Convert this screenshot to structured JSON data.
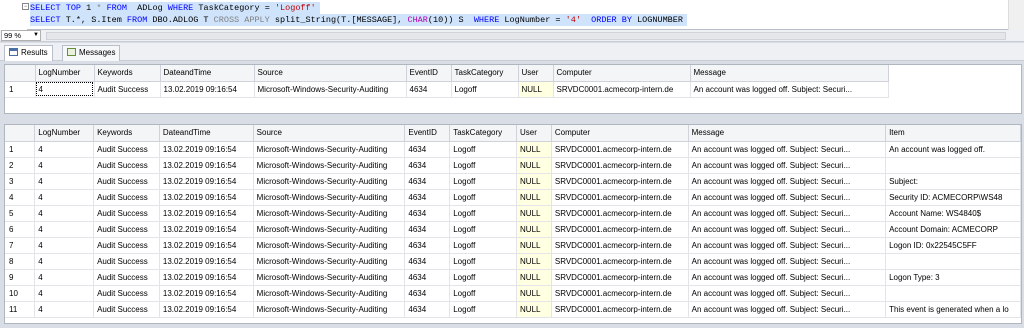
{
  "editor": {
    "line1": {
      "k1": "SELECT",
      "k2": "TOP",
      "n": "1",
      "t1": " * ",
      "k3": "FROM",
      "t2": "  ADLog ",
      "k4": "WHERE",
      "t3": " TaskCategory = ",
      "s": "'Logoff'"
    },
    "line2": {
      "k1": "SELECT",
      "t1": " T.*, S.Item ",
      "k2": "FROM",
      "t2": " DBO.ADLOG T ",
      "k3": "CROSS APPLY",
      "t3": " split_String(T.[MESSAGE], ",
      "fn": "CHAR",
      "t4": "(10)) S  ",
      "k4": "WHERE",
      "t5": " LogNumber = ",
      "s": "'4'",
      "t6": "  ",
      "k5": "ORDER BY",
      "t7": " LOGNUMBER"
    }
  },
  "zoom": "99 %",
  "tabs": {
    "results": "Results",
    "messages": "Messages"
  },
  "columns": [
    "LogNumber",
    "Keywords",
    "DateandTime",
    "Source",
    "EventID",
    "TaskCategory",
    "User",
    "Computer",
    "Message",
    "Item"
  ],
  "result1": [
    {
      "rn": "1",
      "log": "4",
      "kw": "Audit Success",
      "dt": "13.02.2019 09:16:54",
      "src": "Microsoft-Windows-Security-Auditing",
      "eid": "4634",
      "task": "Logoff",
      "user": "NULL",
      "comp": "SRVDC0001.acmecorp-intern.de",
      "msg": "An account was logged off.   Subject:   Securi..."
    }
  ],
  "result2": [
    {
      "rn": "1",
      "item": "An account was logged off."
    },
    {
      "rn": "2",
      "item": ""
    },
    {
      "rn": "3",
      "item": "Subject:"
    },
    {
      "rn": "4",
      "item": "  Security ID:  ACMECORP\\WS48"
    },
    {
      "rn": "5",
      "item": "  Account Name:  WS4840$"
    },
    {
      "rn": "6",
      "item": "  Account Domain:  ACMECORP"
    },
    {
      "rn": "7",
      "item": "  Logon ID:  0x22545C5FF"
    },
    {
      "rn": "8",
      "item": ""
    },
    {
      "rn": "9",
      "item": "  Logon Type:   3"
    },
    {
      "rn": "10",
      "item": ""
    },
    {
      "rn": "11",
      "item": "This event is generated when a lo"
    }
  ],
  "common": {
    "log": "4",
    "kw": "Audit Success",
    "dt": "13.02.2019 09:16:54",
    "src": "Microsoft-Windows-Security-Auditing",
    "eid": "4634",
    "task": "Logoff",
    "user": "NULL",
    "comp": "SRVDC0001.acmecorp-intern.de",
    "msg": "An account was logged off.   Subject:   Securi..."
  }
}
